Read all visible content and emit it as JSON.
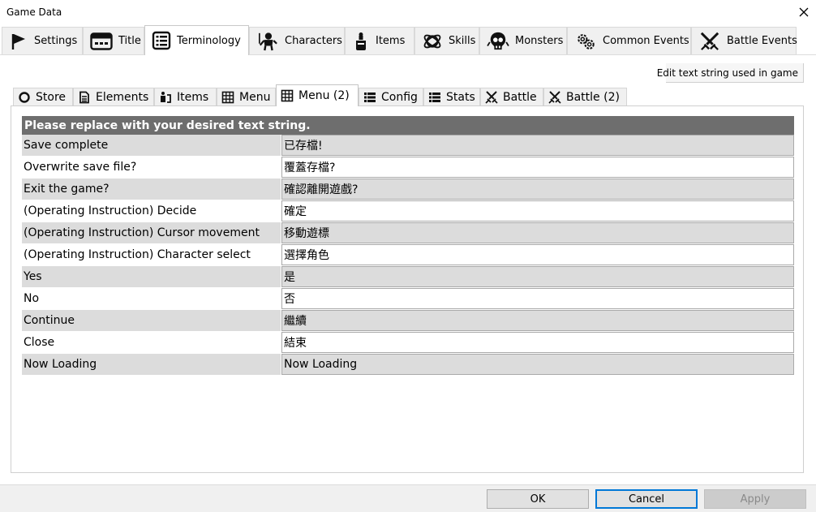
{
  "window": {
    "title": "Game Data",
    "close_glyph": "✕"
  },
  "main_tabs": [
    {
      "label": "Settings",
      "icon": "flag-icon"
    },
    {
      "label": "Title",
      "icon": "title-screen-icon"
    },
    {
      "label": "Terminology",
      "icon": "list-icon",
      "active": true
    },
    {
      "label": "Characters",
      "icon": "character-icon"
    },
    {
      "label": "Items",
      "icon": "potion-icon"
    },
    {
      "label": "Skills",
      "icon": "orbit-icon"
    },
    {
      "label": "Monsters",
      "icon": "monster-icon"
    },
    {
      "label": "Common Events",
      "icon": "gears-icon"
    },
    {
      "label": "Battle Events",
      "icon": "swords-icon"
    }
  ],
  "hint": "Edit text string used in game",
  "sub_tabs": [
    {
      "label": "Store",
      "icon": "circle-icon"
    },
    {
      "label": "Elements",
      "icon": "document-icon"
    },
    {
      "label": "Items",
      "icon": "items-icon"
    },
    {
      "label": "Menu",
      "icon": "grid-icon"
    },
    {
      "label": "Menu (2)",
      "icon": "grid-icon",
      "active": true
    },
    {
      "label": "Config",
      "icon": "list-icon"
    },
    {
      "label": "Stats",
      "icon": "list-icon"
    },
    {
      "label": "Battle",
      "icon": "swords-icon"
    },
    {
      "label": "Battle (2)",
      "icon": "swords-icon"
    }
  ],
  "table": {
    "header": "Please replace with your desired text string.",
    "rows": [
      {
        "key": "Save complete",
        "value": "已存檔!"
      },
      {
        "key": "Overwrite save file?",
        "value": "覆蓋存檔?"
      },
      {
        "key": "Exit the game?",
        "value": "確認離開遊戲?"
      },
      {
        "key": "(Operating Instruction) Decide",
        "value": "確定"
      },
      {
        "key": "(Operating Instruction) Cursor movement",
        "value": "移動遊標"
      },
      {
        "key": "(Operating Instruction) Character select",
        "value": "選擇角色"
      },
      {
        "key": "Yes",
        "value": "是"
      },
      {
        "key": "No",
        "value": "否"
      },
      {
        "key": "Continue",
        "value": "繼續"
      },
      {
        "key": "Close",
        "value": "結束"
      },
      {
        "key": "Now Loading",
        "value": "Now Loading"
      }
    ]
  },
  "footer": {
    "ok": "OK",
    "cancel": "Cancel",
    "apply": "Apply"
  },
  "colors": {
    "header_bg": "#6e6e6e",
    "row_shade": "#dcdcdc",
    "focus_border": "#0078d7",
    "disabled_text": "#8a8a8a"
  }
}
